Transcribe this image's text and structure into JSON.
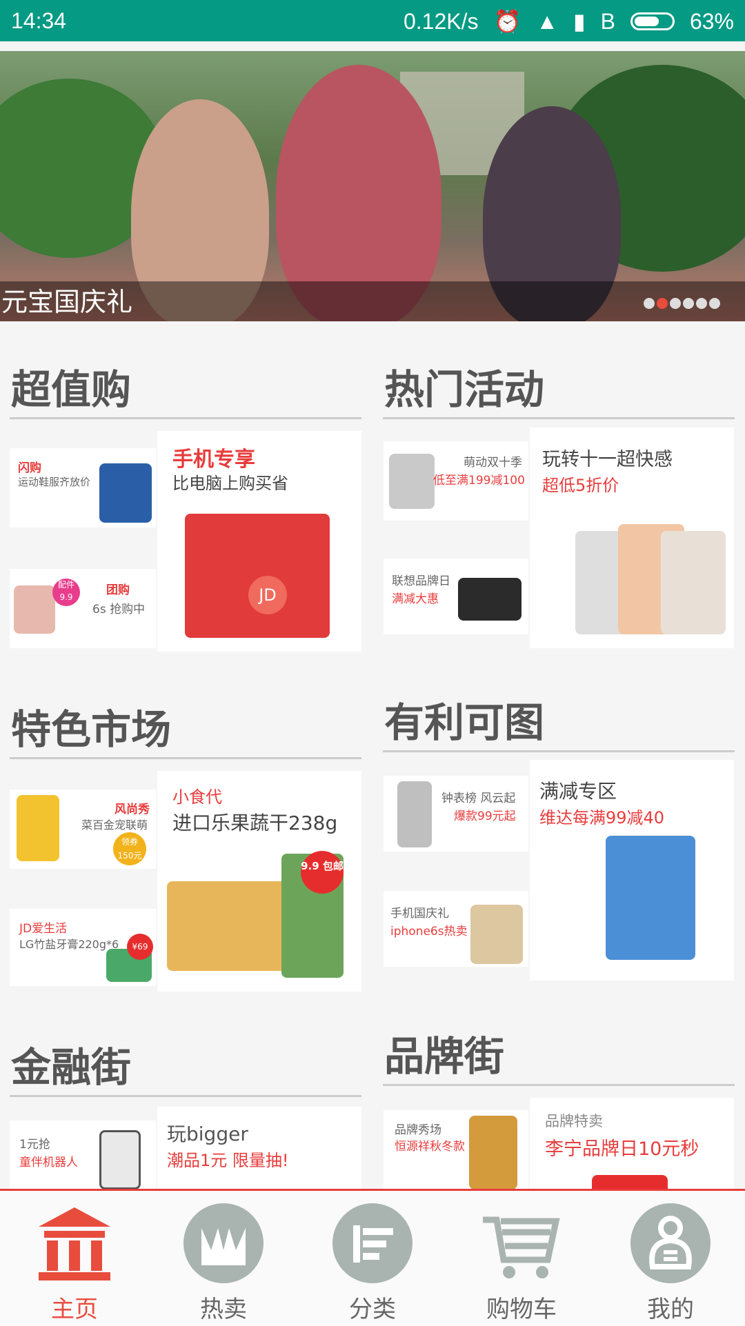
{
  "status_bar": {
    "time": "14:34",
    "speed": "0.12K/s",
    "carrier": "B",
    "battery": "63%"
  },
  "banner": {
    "caption": "元宝国庆礼",
    "dots": 6,
    "active_dot": 1
  },
  "sections": [
    {
      "title": "超值购",
      "left_top": {
        "tag": "闪购",
        "text": "运动鞋服齐放价"
      },
      "left_bottom": {
        "tag": "团购",
        "badge": "配件",
        "badge_price": "9.9",
        "text": "6s 抢购中"
      },
      "big": {
        "title": "手机专享",
        "sub": "比电脑上购买省"
      }
    },
    {
      "title": "热门活动",
      "left_top": {
        "line1": "萌动双十季",
        "line2": "低至满199减100"
      },
      "left_bottom": {
        "line1": "联想品牌日",
        "line2": "满减大惠"
      },
      "big": {
        "title": "玩转十一超快感",
        "sub": "超低5折价"
      }
    },
    {
      "title": "特色市场",
      "left_top": {
        "line1": "风尚秀",
        "line2": "菜百金宠联萌",
        "badge": "领券",
        "badge_price": "150元"
      },
      "left_bottom": {
        "line1": "JD爱生活",
        "line2": "LG竹盐牙膏220g*6",
        "badge": "¥69"
      },
      "big": {
        "title": "小食代",
        "sub": "进口乐果蔬干238g",
        "price_tag": "9.9 包邮"
      }
    },
    {
      "title": "有利可图",
      "left_top": {
        "line1": "钟表榜 风云起",
        "line2": "爆款99元起"
      },
      "left_bottom": {
        "line1": "手机国庆礼",
        "line2": "iphone6s热卖"
      },
      "big": {
        "title": "满减专区",
        "sub": "维达每满99减40"
      }
    },
    {
      "title": "金融街",
      "left_top": {
        "line1": "1元抢",
        "line2": "童伴机器人"
      },
      "big": {
        "title": "玩bigger",
        "sub": "潮品1元 限量抽!"
      }
    },
    {
      "title": "品牌街",
      "left_top": {
        "line1": "品牌秀场",
        "line2": "恒源祥秋冬款"
      },
      "big": {
        "title": "品牌特卖",
        "sub": "李宁品牌日10元秒"
      }
    }
  ],
  "tabbar": [
    {
      "label": "主页",
      "icon": "home-icon"
    },
    {
      "label": "热卖",
      "icon": "hot-icon"
    },
    {
      "label": "分类",
      "icon": "category-icon"
    },
    {
      "label": "购物车",
      "icon": "cart-icon"
    },
    {
      "label": "我的",
      "icon": "profile-icon"
    }
  ],
  "colors": {
    "accent": "#e84c3d",
    "status": "#049a84",
    "icon_gray": "#a9b4b0"
  }
}
